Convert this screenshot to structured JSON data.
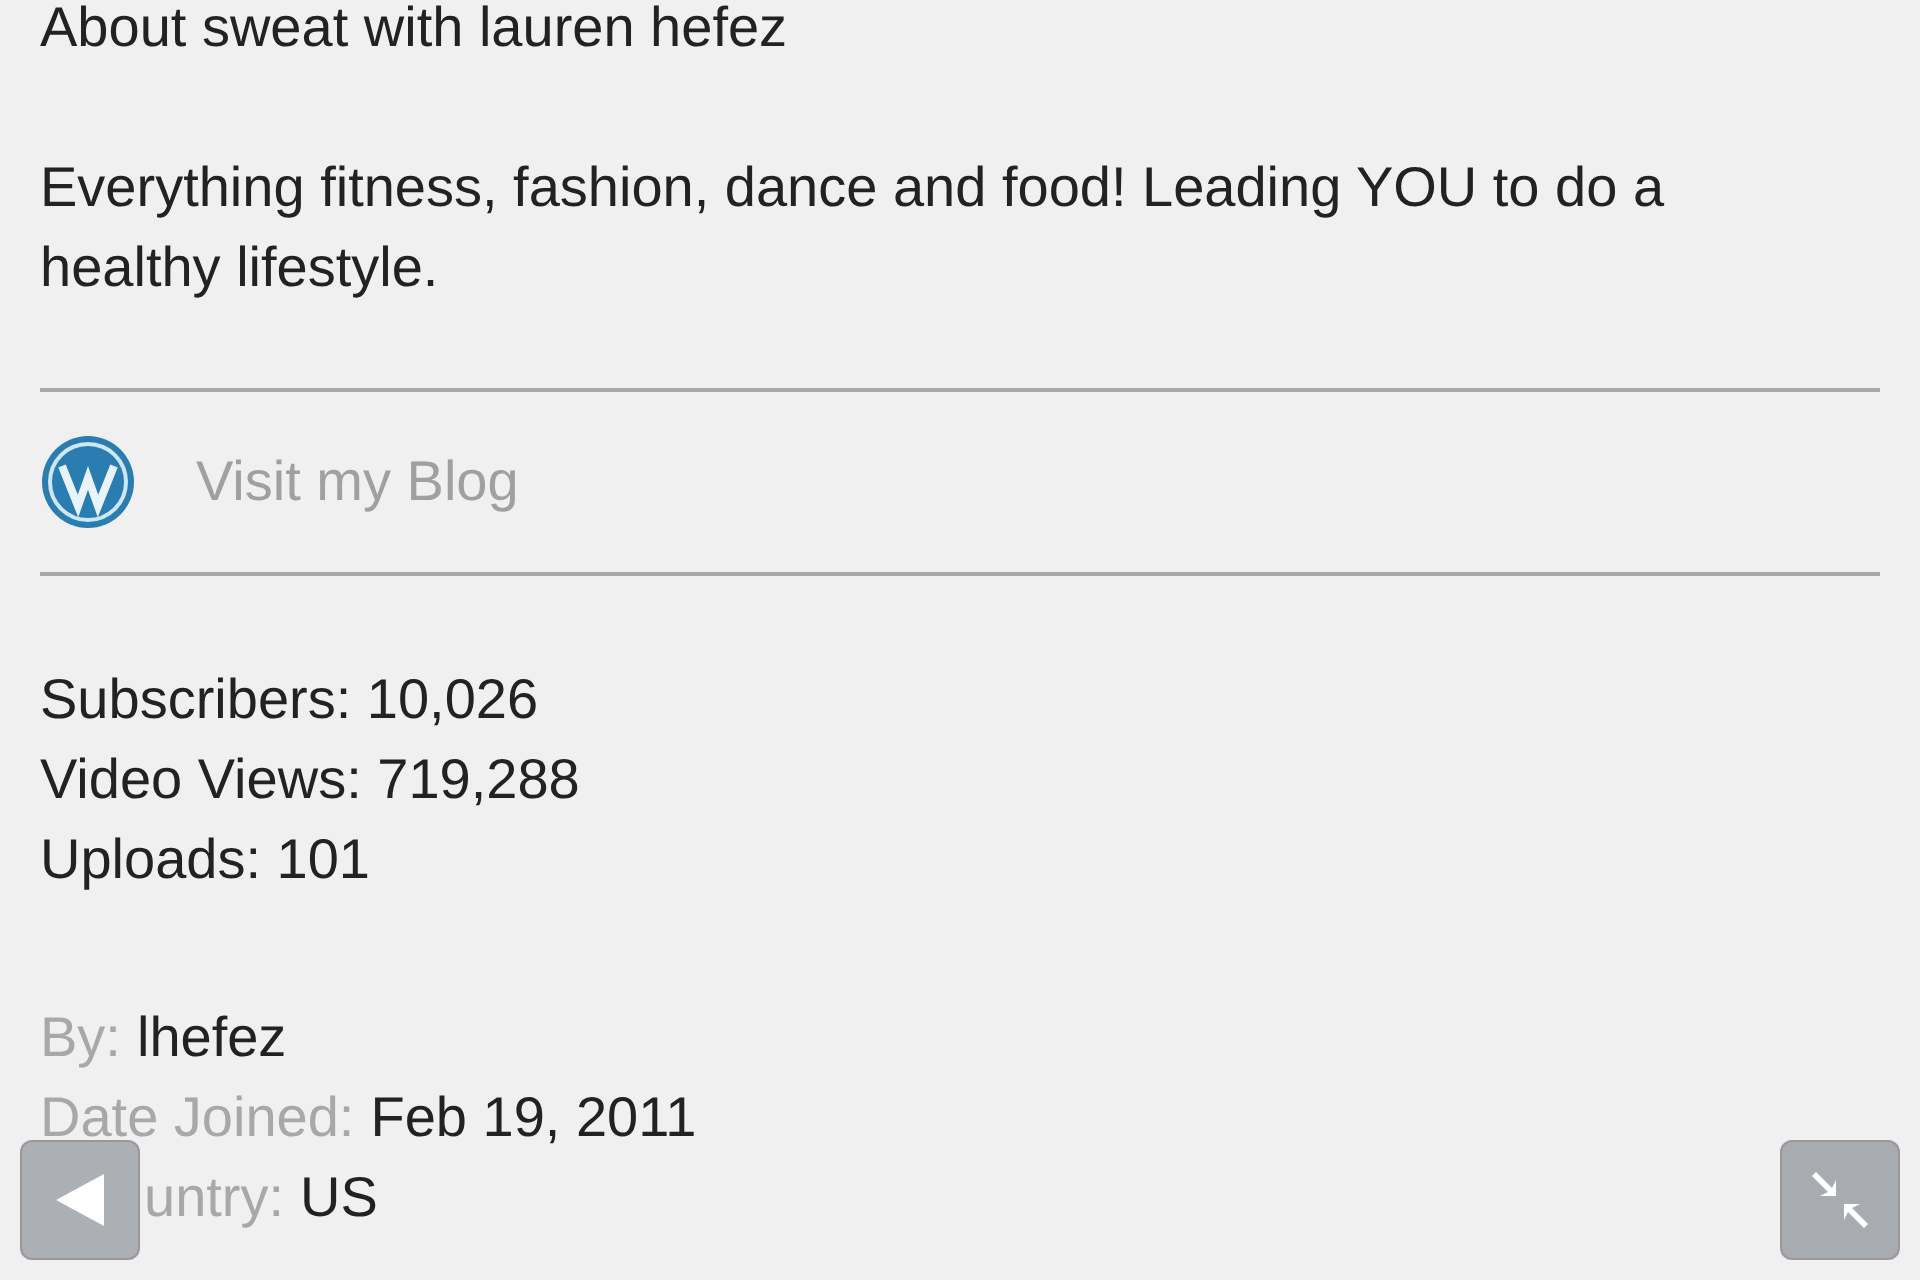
{
  "about": {
    "title": "About sweat with lauren hefez",
    "description": "Everything fitness, fashion, dance and food! Leading YOU to do a healthy lifestyle."
  },
  "blog_link": {
    "label": "Visit my Blog"
  },
  "stats": [
    {
      "text": "Subscribers: 10,026"
    },
    {
      "text": "Video Views: 719,288"
    },
    {
      "text": "Uploads: 101"
    }
  ],
  "details": [
    {
      "label": "By:",
      "value": "lhefez"
    },
    {
      "label": "Date Joined:",
      "value": "Feb 19, 2011"
    },
    {
      "label": "untry:",
      "value": "US"
    }
  ]
}
